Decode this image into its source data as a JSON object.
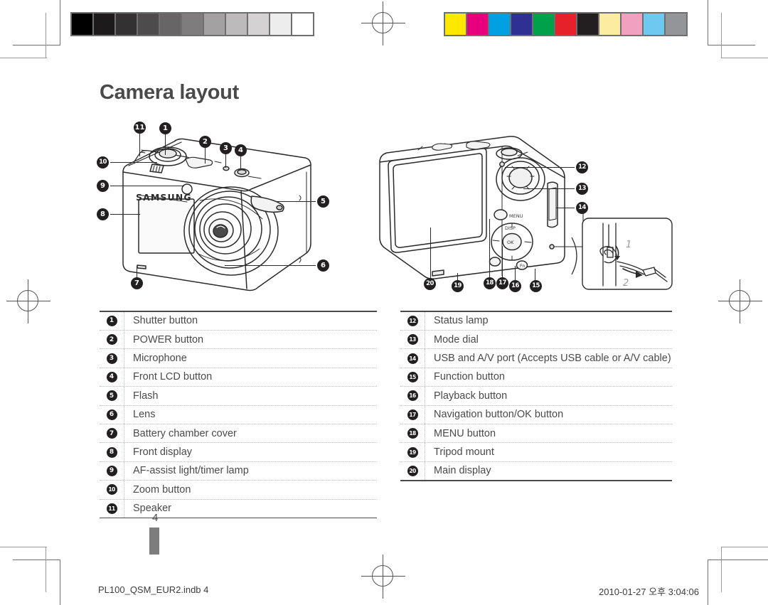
{
  "document": {
    "title": "Camera layout",
    "page_number": "4",
    "footer_left": "PL100_QSM_EUR2.indb   4",
    "footer_right": "2010-01-27   오후 3:04:06"
  },
  "print_marks": {
    "grayscale_swatches": [
      "#000000",
      "#1c1a1a",
      "#333131",
      "#4d4b4b",
      "#676565",
      "#7e7c7c",
      "#a3a1a1",
      "#bcbaba",
      "#d4d2d2",
      "#eeeded",
      "#ffffff"
    ],
    "color_swatches": [
      "#ffe800",
      "#e6007e",
      "#00a0e3",
      "#2e3191",
      "#00a14b",
      "#e62129",
      "#231f20",
      "#faeda0",
      "#f2a0c0",
      "#6ec9f0",
      "#939598"
    ],
    "registration_icon": "registration-target-icon"
  },
  "illustrations": {
    "front_view": {
      "name": "camera-front-illustration",
      "brand_text": "SAMSUNG",
      "callouts": [
        "11",
        "1",
        "2",
        "3",
        "4",
        "10",
        "9",
        "8",
        "5",
        "6",
        "7"
      ]
    },
    "back_view": {
      "name": "camera-back-illustration",
      "callouts": [
        "12",
        "13",
        "14",
        "15",
        "16",
        "17",
        "18",
        "19",
        "20"
      ],
      "dial_label": "MENU",
      "disp_label": "DISP",
      "ok_label": "OK",
      "fn_label": "Fn"
    },
    "strap_inset": {
      "name": "strap-attachment-inset",
      "step_one": "1",
      "step_two": "2"
    }
  },
  "legend": {
    "left_column": [
      {
        "num": "1",
        "glyph": "❶",
        "label": "Shutter button"
      },
      {
        "num": "2",
        "glyph": "❷",
        "label": "POWER button"
      },
      {
        "num": "3",
        "glyph": "❸",
        "label": "Microphone"
      },
      {
        "num": "4",
        "glyph": "❹",
        "label": "Front LCD button"
      },
      {
        "num": "5",
        "glyph": "❺",
        "label": "Flash"
      },
      {
        "num": "6",
        "glyph": "❻",
        "label": "Lens"
      },
      {
        "num": "7",
        "glyph": "❼",
        "label": "Battery chamber cover"
      },
      {
        "num": "8",
        "glyph": "❽",
        "label": "Front display"
      },
      {
        "num": "9",
        "glyph": "❾",
        "label": "AF-assist light/timer lamp"
      },
      {
        "num": "10",
        "glyph": "❿",
        "label": "Zoom button"
      },
      {
        "num": "11",
        "glyph": "⓫",
        "label": "Speaker"
      }
    ],
    "right_column": [
      {
        "num": "12",
        "glyph": "⓬",
        "label": "Status lamp"
      },
      {
        "num": "13",
        "glyph": "⓭",
        "label": "Mode dial"
      },
      {
        "num": "14",
        "glyph": "⓮",
        "label": "USB and A/V port (Accepts USB cable or A/V cable)"
      },
      {
        "num": "15",
        "glyph": "⓯",
        "label": "Function button"
      },
      {
        "num": "16",
        "glyph": "⓰",
        "label": "Playback button"
      },
      {
        "num": "17",
        "glyph": "⓱",
        "label": "Navigation button/OK button"
      },
      {
        "num": "18",
        "glyph": "⓲",
        "label": "MENU button"
      },
      {
        "num": "19",
        "glyph": "⓳",
        "label": "Tripod mount"
      },
      {
        "num": "20",
        "glyph": "⓴",
        "label": "Main display"
      }
    ]
  }
}
